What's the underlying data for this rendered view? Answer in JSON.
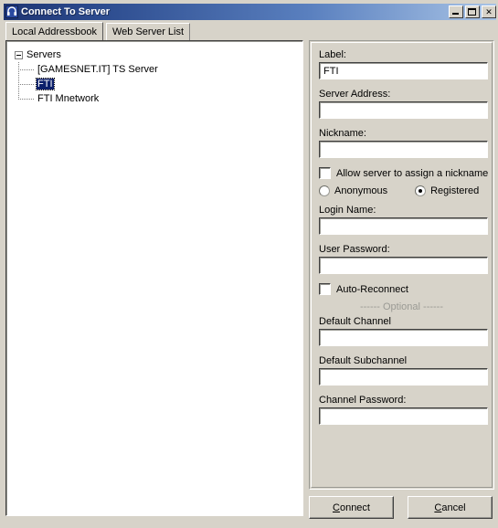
{
  "window": {
    "title": "Connect To Server",
    "icon": "headset-icon",
    "controls": {
      "minimize": "Minimize",
      "maximize": "Maximize",
      "close": "Close"
    },
    "titlebar_color": "#1f3572",
    "background_color": "#d7d3c9"
  },
  "tabs": [
    {
      "label": "Local Addressbook",
      "active": true
    },
    {
      "label": "Web Server List",
      "active": false
    }
  ],
  "tree": {
    "root": {
      "label": "Servers",
      "expanded": true
    },
    "items": [
      {
        "label": "[GAMESNET.IT] TS Server",
        "selected": false
      },
      {
        "label": "FTI",
        "selected": true
      },
      {
        "label": "FTI Mnetwork",
        "selected": false
      }
    ],
    "selection_color": "#0c1f6b"
  },
  "form": {
    "label_field": {
      "label": "Label:",
      "value": "FTI",
      "placeholder": ""
    },
    "server_address_field": {
      "label": "Server Address:",
      "value": "",
      "placeholder": ""
    },
    "nickname_field": {
      "label": "Nickname:",
      "value": "",
      "placeholder": ""
    },
    "allow_server_nickname": {
      "label": "Allow server to assign a nickname",
      "checked": false
    },
    "auth_mode": {
      "anonymous": {
        "label": "Anonymous",
        "selected": false
      },
      "registered": {
        "label": "Registered",
        "selected": true
      }
    },
    "login_name_field": {
      "label": "Login Name:",
      "value": "",
      "placeholder": ""
    },
    "user_password_field": {
      "label": "User Password:",
      "value": "",
      "placeholder": ""
    },
    "auto_reconnect": {
      "label": "Auto-Reconnect",
      "checked": false
    },
    "optional_separator": "------ Optional ------",
    "default_channel_field": {
      "label": "Default Channel",
      "value": "",
      "placeholder": ""
    },
    "default_subchannel_field": {
      "label": "Default Subchannel",
      "value": "",
      "placeholder": ""
    },
    "channel_password_field": {
      "label": "Channel Password:",
      "value": "",
      "placeholder": ""
    }
  },
  "buttons": {
    "connect": {
      "accesskey": "C",
      "rest": "onnect"
    },
    "cancel": {
      "accesskey": "C",
      "rest": "ancel"
    }
  }
}
